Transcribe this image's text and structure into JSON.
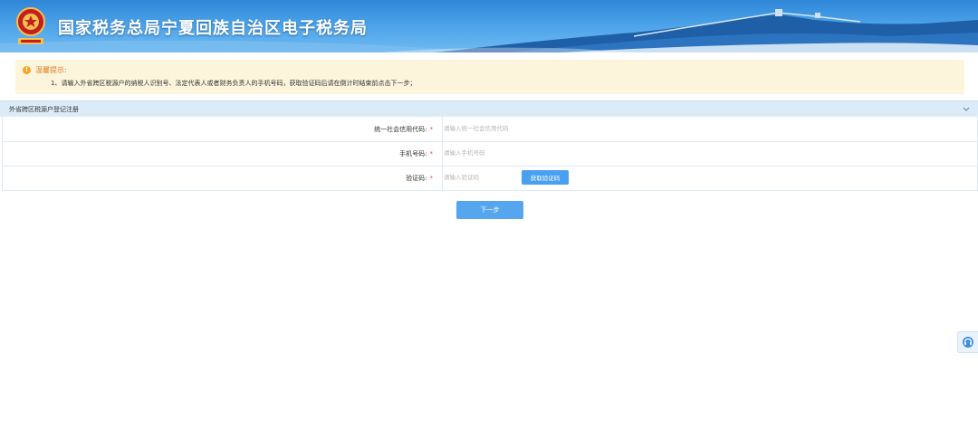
{
  "header": {
    "title": "国家税务总局宁夏回族自治区电子税务局",
    "logo_icon": "tax-emblem-icon"
  },
  "notice": {
    "heading": "温馨提示:",
    "text": "1、请输入外省跨区税源户的纳税人识别号、法定代表人或者财务负责人的手机号码，获取验证码后请在倒计时结束前点击下一步；",
    "icon": "info-icon"
  },
  "section": {
    "title": "外省跨区税源户登记注册",
    "collapse_icon": "chevron-down-icon"
  },
  "form": {
    "rows": [
      {
        "label": "统一社会信用代码:",
        "required_mark": "*",
        "placeholder": "请输入统一社会信用代码",
        "value": ""
      },
      {
        "label": "手机号码:",
        "required_mark": "*",
        "placeholder": "请输入手机号码",
        "value": ""
      },
      {
        "label": "验证码:",
        "required_mark": "*",
        "placeholder": "请输入验证码",
        "value": ""
      }
    ],
    "get_code_label": "获取验证码",
    "next_label": "下一步"
  },
  "floating": {
    "icon": "customer-service-icon"
  },
  "colors": {
    "banner": "#3a8fdc",
    "notice_bg": "#fdf4dc",
    "notice_accent": "#f5a623",
    "section_bg": "#dcebf8",
    "primary": "#56a6ef",
    "required": "#e5534b"
  }
}
